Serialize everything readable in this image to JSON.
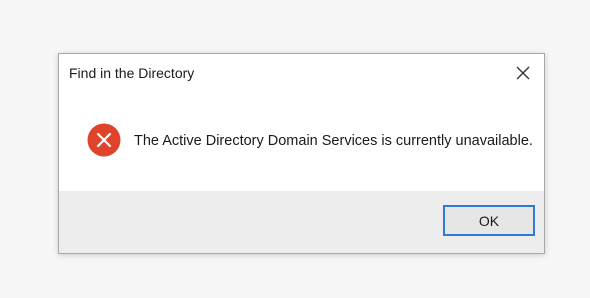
{
  "dialog": {
    "title": "Find in the Directory",
    "message": "The Active Directory Domain Services is currently unavailable.",
    "ok_label": "OK",
    "icons": {
      "close": "close-icon",
      "error": "error-icon"
    },
    "colors": {
      "error_red": "#e0432c",
      "focus_border": "#2f7bd3",
      "footer_bg": "#ededed"
    }
  }
}
